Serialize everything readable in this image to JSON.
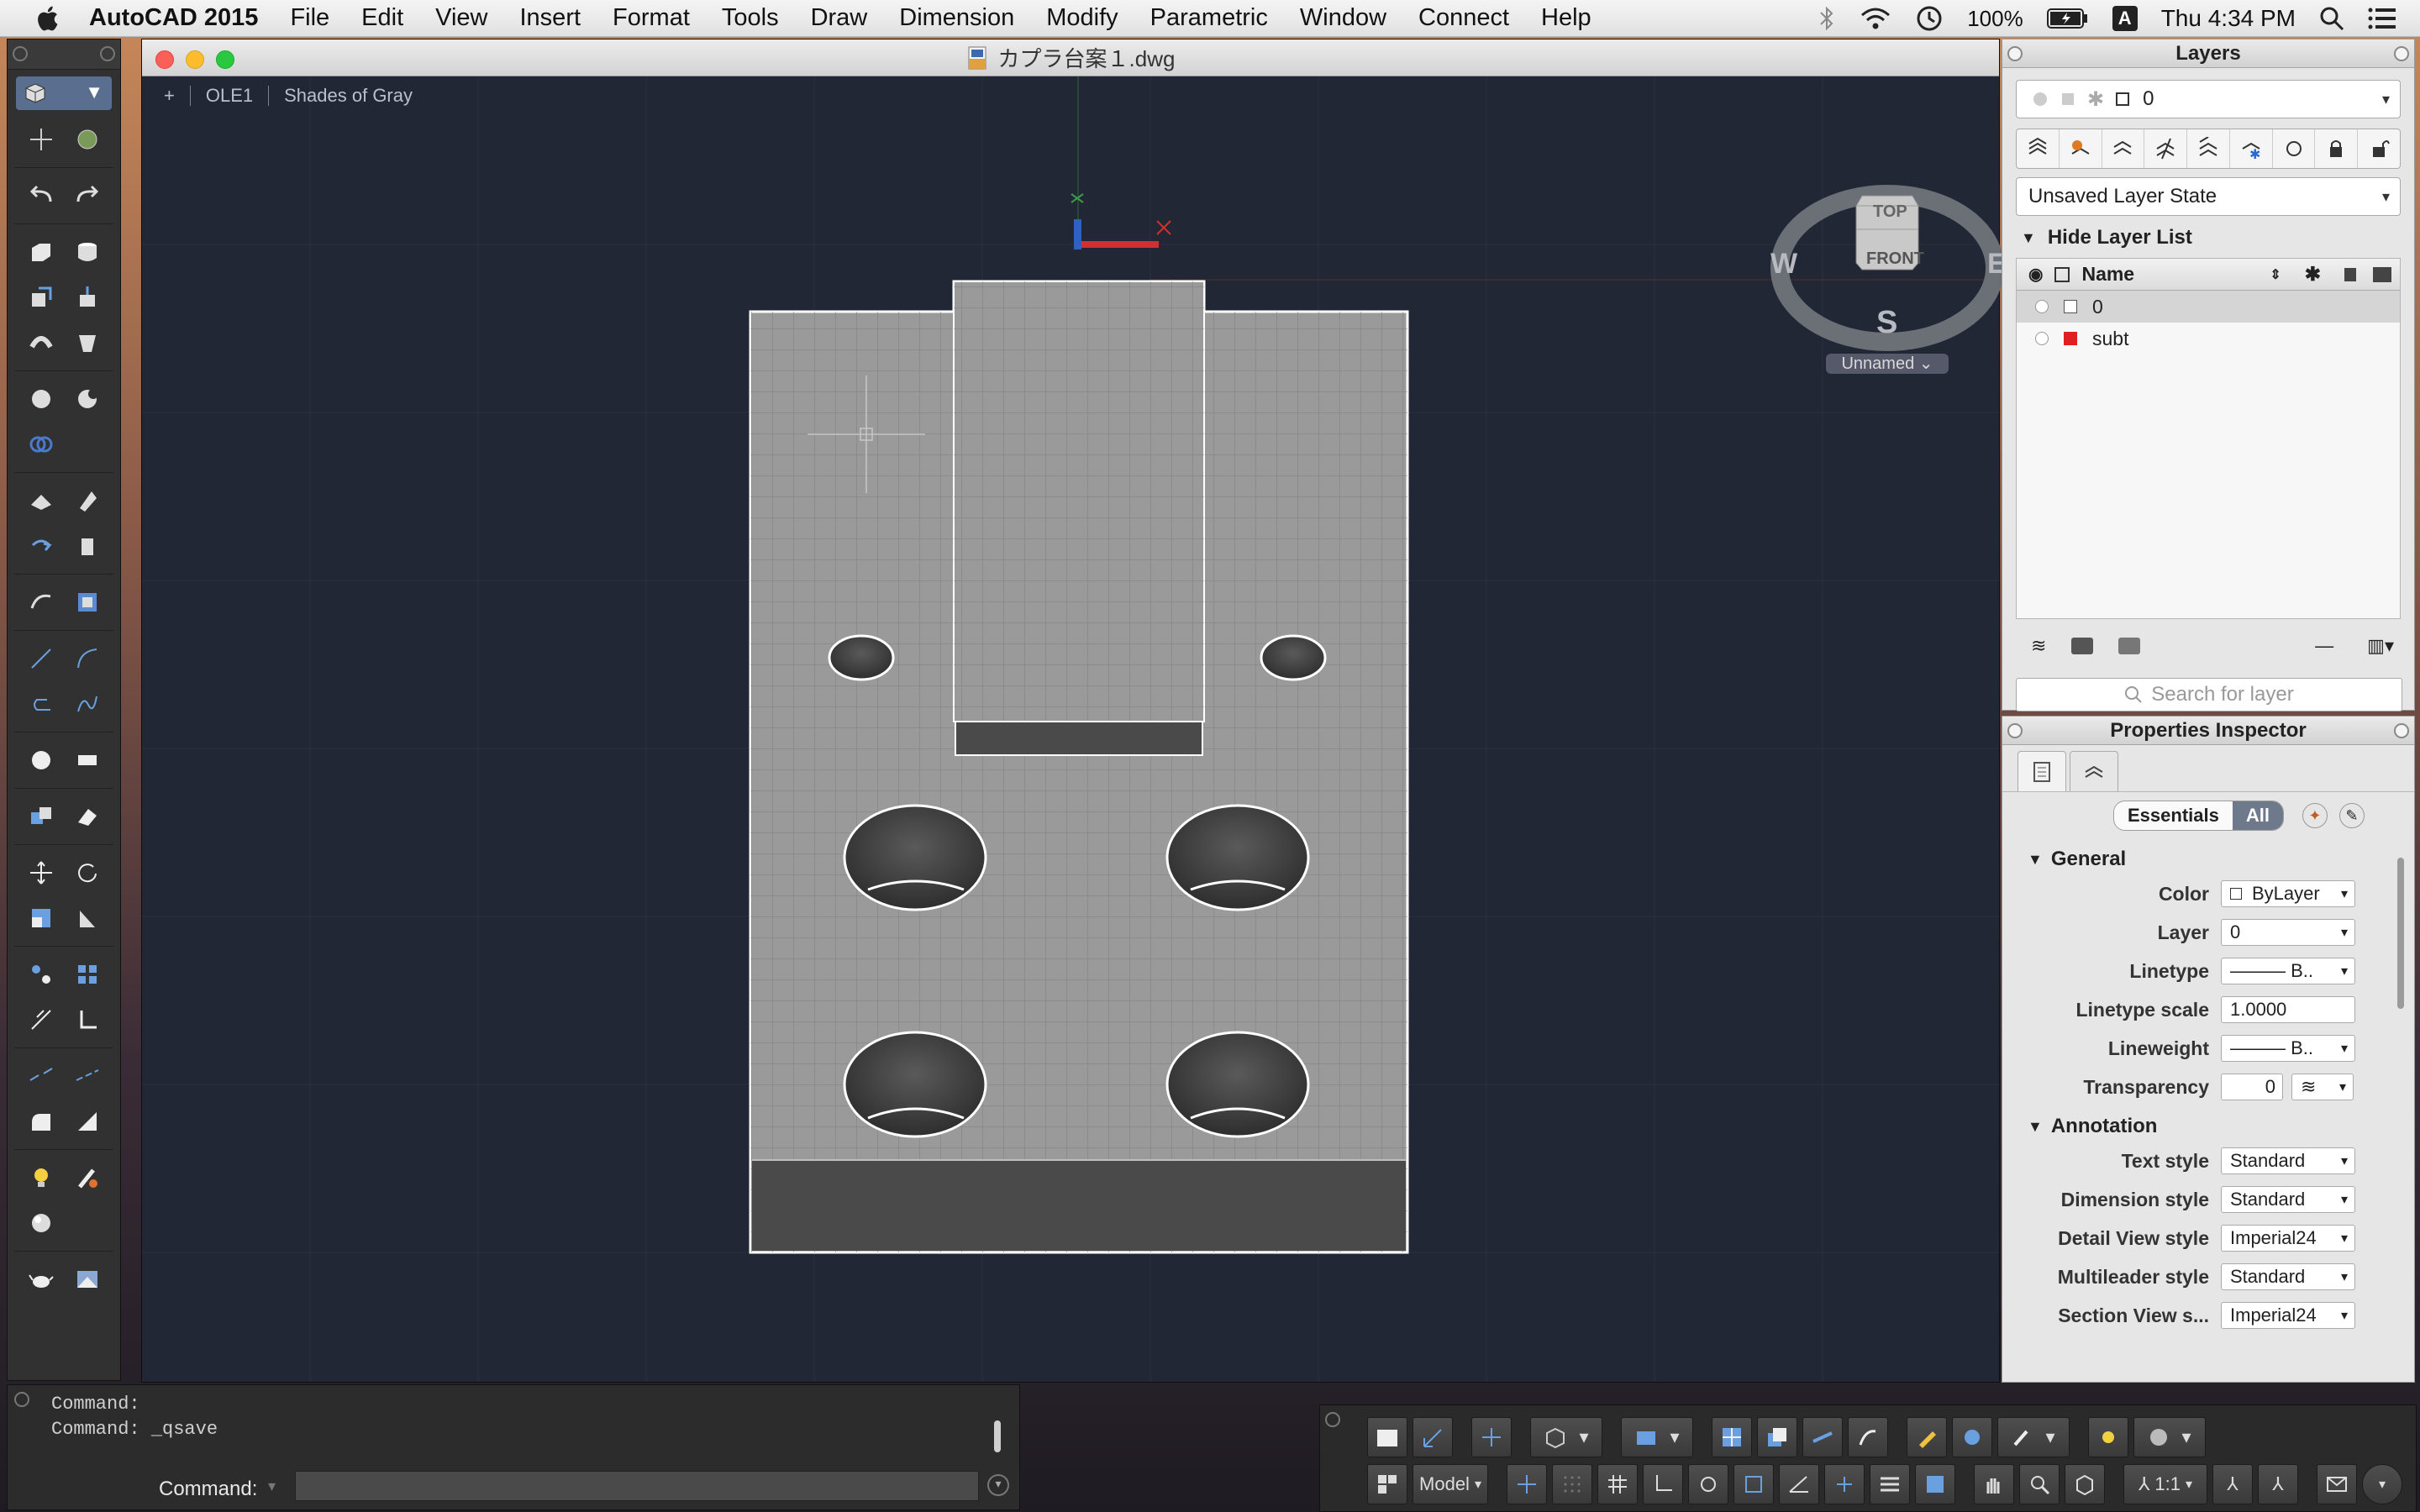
{
  "menubar": {
    "app_name": "AutoCAD 2015",
    "menus": [
      "File",
      "Edit",
      "View",
      "Insert",
      "Format",
      "Tools",
      "Draw",
      "Dimension",
      "Modify",
      "Parametric",
      "Window",
      "Connect",
      "Help"
    ],
    "battery": "100%",
    "clock": "Thu 4:34 PM",
    "input_source": "A"
  },
  "drawing": {
    "title": "カプラ台案１.dwg",
    "viewport_plus": "+",
    "viewport_name": "OLE1",
    "visual_style": "Shades of Gray"
  },
  "viewcube": {
    "top": "TOP",
    "front": "FRONT",
    "west": "W",
    "east": "E",
    "south": "S",
    "ucs_label": "Unnamed"
  },
  "layers_panel": {
    "title": "Layers",
    "current_layer": "0",
    "layer_state": "Unsaved Layer State",
    "toggle_label": "Hide Layer List",
    "column_name": "Name",
    "layers": [
      {
        "name": "0",
        "color": "#ffffff",
        "selected": true
      },
      {
        "name": "subt",
        "color": "#e02020",
        "selected": false
      }
    ],
    "search_placeholder": "Search for layer"
  },
  "properties_panel": {
    "title": "Properties Inspector",
    "seg_essentials": "Essentials",
    "seg_all": "All",
    "general_header": "General",
    "general": [
      {
        "label": "Color",
        "value": "ByLayer"
      },
      {
        "label": "Layer",
        "value": "0"
      },
      {
        "label": "Linetype",
        "value": "——— B.."
      },
      {
        "label": "Linetype scale",
        "value": "1.0000"
      },
      {
        "label": "Lineweight",
        "value": "——— B.."
      },
      {
        "label": "Transparency",
        "value": "0"
      }
    ],
    "annotation_header": "Annotation",
    "annotation": [
      {
        "label": "Text style",
        "value": "Standard"
      },
      {
        "label": "Dimension style",
        "value": "Standard"
      },
      {
        "label": "Detail View style",
        "value": "Imperial24"
      },
      {
        "label": "Multileader style",
        "value": "Standard"
      },
      {
        "label": "Section View s...",
        "value": "Imperial24"
      }
    ]
  },
  "command_line": {
    "history_1": "Command:",
    "history_2": "Command:  _qsave",
    "prompt": "Command:"
  },
  "statusbar": {
    "space": "Model",
    "scale": "1:1"
  },
  "colors": {
    "canvas_bg": "#212734",
    "part_fill": "#9a9a9a",
    "part_dark": "#4a4a4a",
    "x_axis": "#d03030",
    "z_axis": "#3060c0",
    "accent_blue": "#5a6e90"
  }
}
